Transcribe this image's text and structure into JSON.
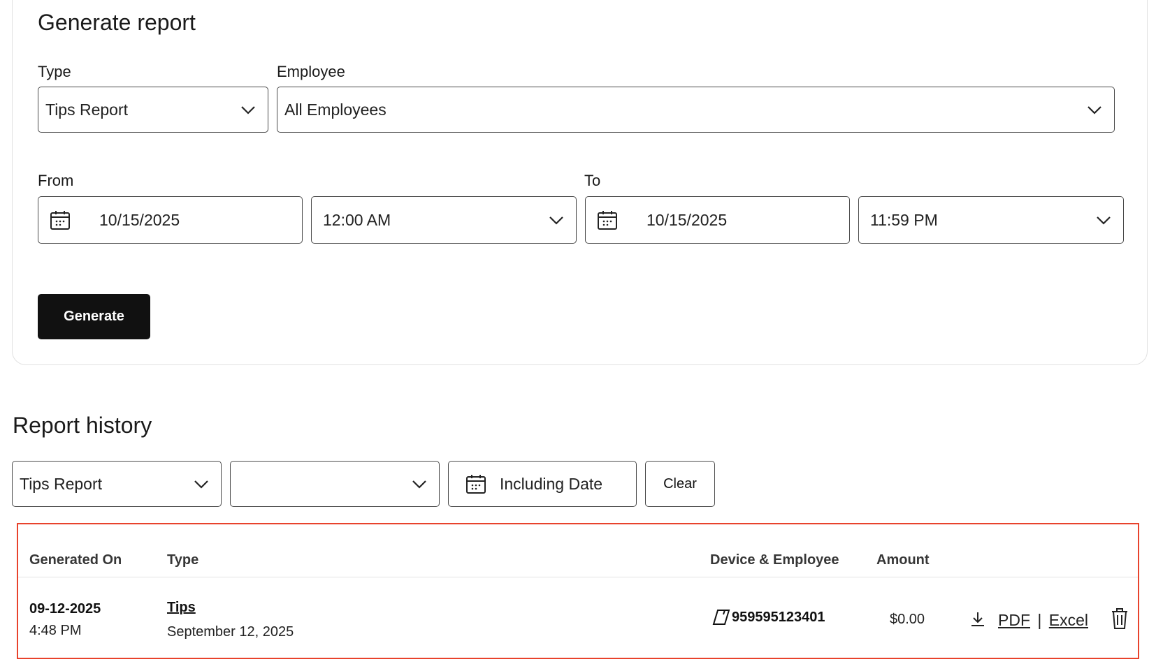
{
  "generate": {
    "title": "Generate report",
    "type_label": "Type",
    "type_value": "Tips Report",
    "employee_label": "Employee",
    "employee_value": "All Employees",
    "from_label": "From",
    "from_date": "10/15/2025",
    "from_time": "12:00 AM",
    "to_label": "To",
    "to_date": "10/15/2025",
    "to_time": "11:59 PM",
    "generate_button": "Generate"
  },
  "history": {
    "title": "Report history",
    "filter_type": "Tips Report",
    "filter_second": "",
    "date_filter": "Including Date",
    "clear_button": "Clear",
    "columns": {
      "generated_on": "Generated On",
      "type": "Type",
      "device_employee": "Device & Employee",
      "amount": "Amount"
    },
    "rows": [
      {
        "date": "09-12-2025",
        "time": "4:48 PM",
        "type": "Tips",
        "type_date": "September 12, 2025",
        "device": "959595123401",
        "amount": "$0.00",
        "pdf": "PDF",
        "separator": "|",
        "excel": "Excel"
      }
    ]
  },
  "icons": {
    "chevron": "chevron-down-icon",
    "calendar": "calendar-icon",
    "download": "download-icon",
    "trash": "trash-icon",
    "device": "card-reader-icon"
  },
  "colors": {
    "primary_button": "#111111",
    "highlight_border": "#e8432c",
    "border": "#4a4a4a"
  }
}
